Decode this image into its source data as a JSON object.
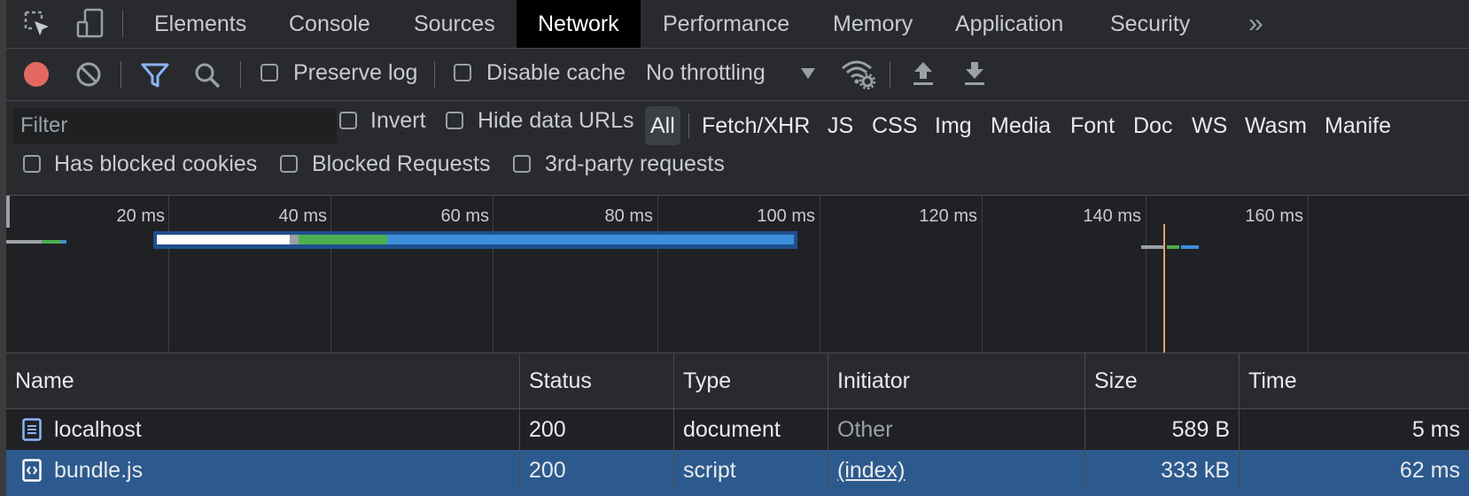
{
  "tabs": [
    {
      "label": "Elements"
    },
    {
      "label": "Console"
    },
    {
      "label": "Sources"
    },
    {
      "label": "Network",
      "active": true
    },
    {
      "label": "Performance"
    },
    {
      "label": "Memory"
    },
    {
      "label": "Application"
    },
    {
      "label": "Security"
    }
  ],
  "tab_overflow": "»",
  "toolbar": {
    "preserve_log": "Preserve log",
    "disable_cache": "Disable cache",
    "throttling": "No throttling"
  },
  "filter": {
    "placeholder": "Filter",
    "invert": "Invert",
    "hide_data_urls": "Hide data URLs",
    "types": [
      "All",
      "Fetch/XHR",
      "JS",
      "CSS",
      "Img",
      "Media",
      "Font",
      "Doc",
      "WS",
      "Wasm",
      "Manife"
    ],
    "has_blocked_cookies": "Has blocked cookies",
    "blocked_requests": "Blocked Requests",
    "third_party": "3rd-party requests"
  },
  "timeline": {
    "ticks": [
      "20 ms",
      "40 ms",
      "60 ms",
      "80 ms",
      "100 ms",
      "120 ms",
      "140 ms",
      "160 ms"
    ]
  },
  "table": {
    "columns": [
      "Name",
      "Status",
      "Type",
      "Initiator",
      "Size",
      "Time"
    ],
    "rows": [
      {
        "name": "localhost",
        "status": "200",
        "type": "document",
        "initiator": "Other",
        "size": "589 B",
        "time": "5 ms"
      },
      {
        "name": "bundle.js",
        "status": "200",
        "type": "script",
        "initiator": "(index)",
        "size": "333 kB",
        "time": "62 ms",
        "selected": true
      }
    ]
  },
  "colors": {
    "record": "#e46962",
    "filter_active": "#8ab4f8",
    "bar_waiting": "#4caf50",
    "bar_download": "#3d8fdb",
    "bar_border": "#1f4f8f",
    "selected_row": "#2d5a8e",
    "load_marker": "#e8a064"
  }
}
